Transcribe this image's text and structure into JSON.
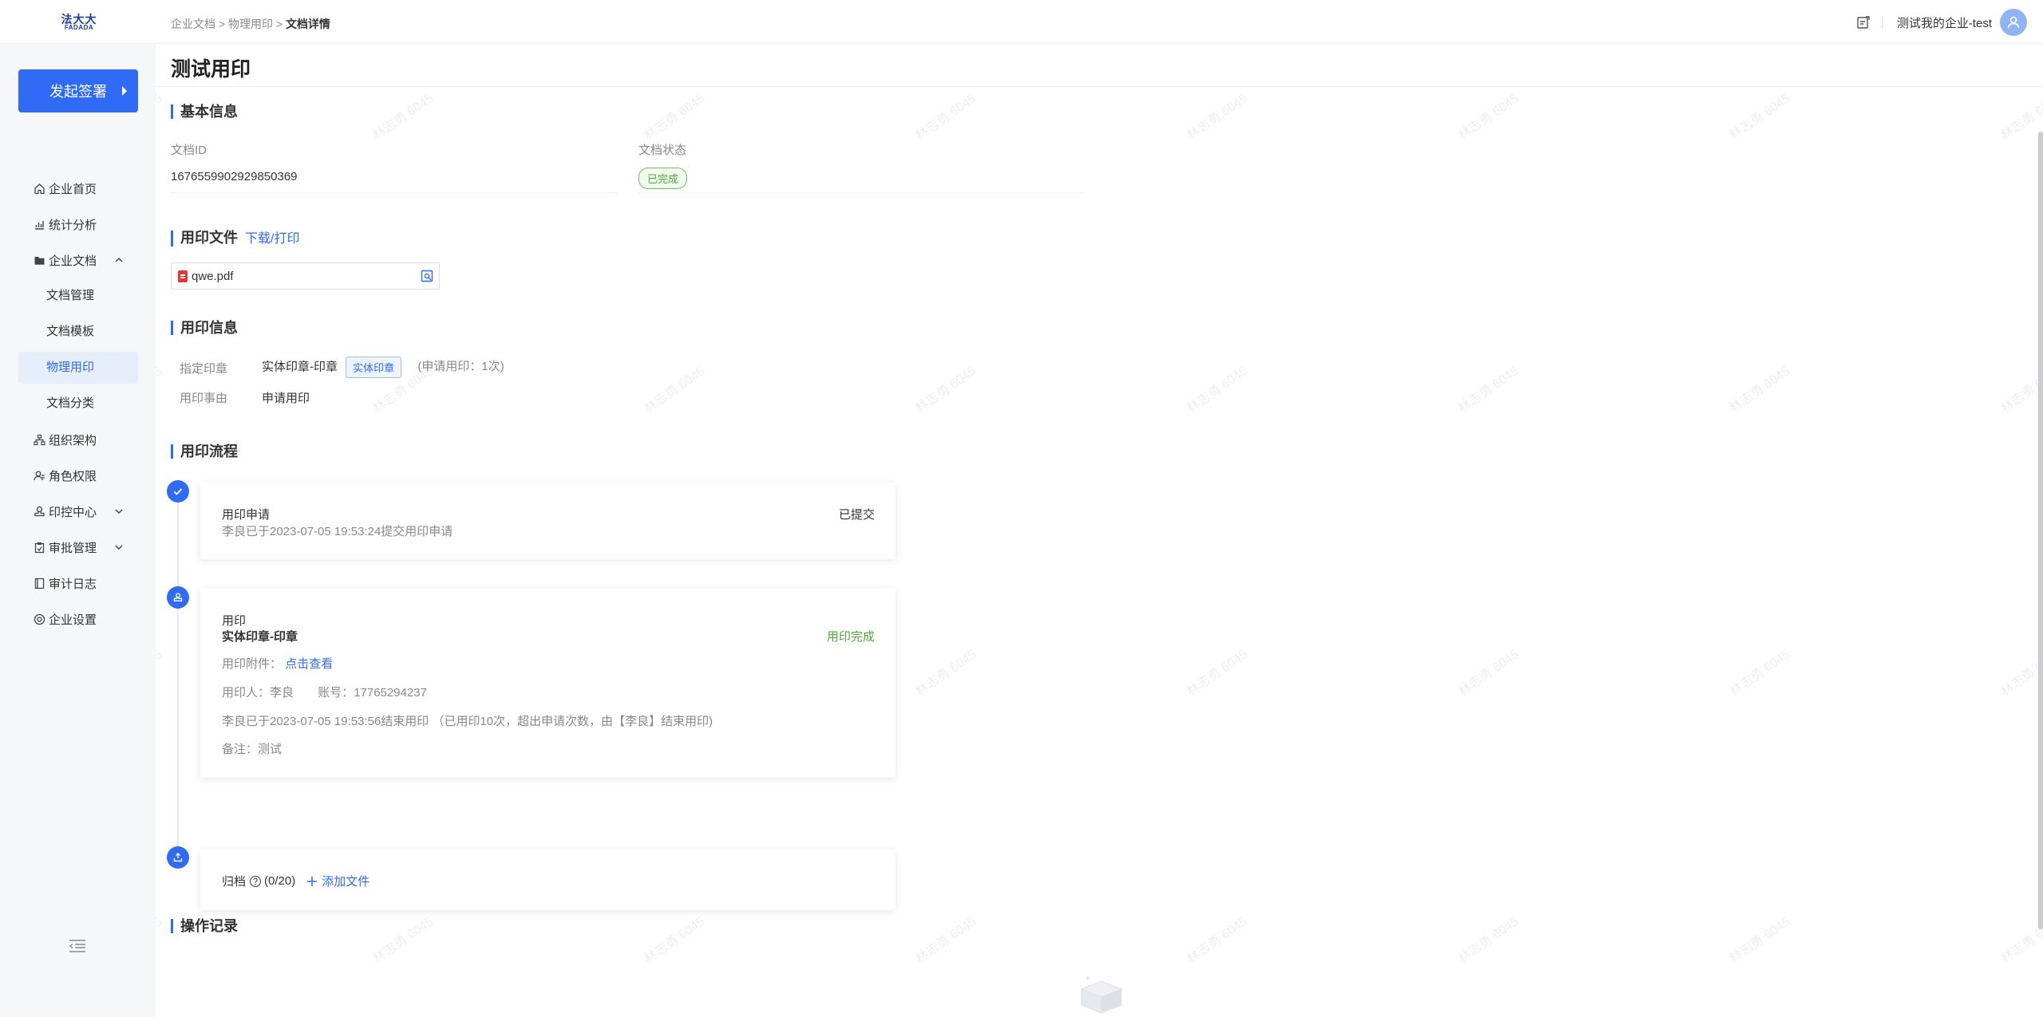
{
  "header": {
    "logo_cn": "法大大",
    "logo_en": "FADADA",
    "breadcrumb": [
      "企业文档",
      "物理用印",
      "文档详情"
    ],
    "breadcrumb_sep": ">",
    "company_name": "测试我的企业-test"
  },
  "sidebar": {
    "start_button": "发起签署",
    "items": [
      {
        "label": "企业首页",
        "icon": "home-icon"
      },
      {
        "label": "统计分析",
        "icon": "chart-icon"
      },
      {
        "label": "企业文档",
        "icon": "folder-icon"
      },
      {
        "label": "文档管理"
      },
      {
        "label": "文档模板"
      },
      {
        "label": "物理用印"
      },
      {
        "label": "文档分类"
      },
      {
        "label": "组织架构",
        "icon": "org-icon"
      },
      {
        "label": "角色权限",
        "icon": "role-icon"
      },
      {
        "label": "印控中心",
        "icon": "seal-icon"
      },
      {
        "label": "审批管理",
        "icon": "approval-icon"
      },
      {
        "label": "审计日志",
        "icon": "log-icon"
      },
      {
        "label": "企业设置",
        "icon": "settings-icon"
      }
    ]
  },
  "page": {
    "title": "测试用印",
    "basic": {
      "title": "基本信息",
      "doc_id_label": "文档ID",
      "doc_id": "1676559902929850369",
      "status_label": "文档状态",
      "status": "已完成"
    },
    "file": {
      "title": "用印文件",
      "link": "下载/打印",
      "filename": "qwe.pdf"
    },
    "seal_info": {
      "title": "用印信息",
      "seal_label": "指定印章",
      "seal_name": "实体印章-印章",
      "seal_tag": "实体印章",
      "seal_count": "(申请用印：1次)",
      "reason_label": "用印事由",
      "reason": "申请用印"
    },
    "flow": {
      "title": "用印流程",
      "step1": {
        "title": "用印申请",
        "desc": "李良已于2023-07-05 19:53:24提交用印申请",
        "status": "已提交"
      },
      "step2": {
        "title": "用印",
        "seal": "实体印章-印章",
        "status": "用印完成",
        "attach_label": "用印附件：",
        "attach_link": "点击查看",
        "user": "用印人：李良",
        "account": "账号：17765294237",
        "desc": "李良已于2023-07-05 19:53:56结束用印 （已用印10次，超出申请次数，由【李良】结束用印)",
        "remark": "备注：测试"
      },
      "step3": {
        "title": "归档",
        "count": "(0/20)",
        "add": "添加文件"
      }
    },
    "ops": {
      "title": "操作记录"
    },
    "watermark": "林志勇 6045"
  }
}
